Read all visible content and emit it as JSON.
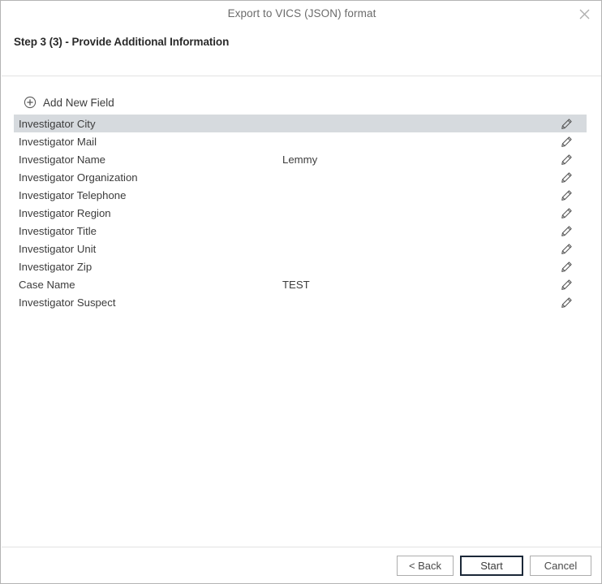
{
  "window": {
    "title": "Export to VICS (JSON) format",
    "close_icon": "close-icon"
  },
  "step": {
    "heading": "Step 3 (3) - Provide Additional Information"
  },
  "toolbar": {
    "add_field_label": "Add New Field",
    "add_field_icon": "plus-circle-icon"
  },
  "list": {
    "edit_icon": "pencil-icon",
    "selected_index": 0,
    "rows": [
      {
        "name": "Investigator City",
        "value": ""
      },
      {
        "name": "Investigator Mail",
        "value": ""
      },
      {
        "name": "Investigator Name",
        "value": "Lemmy"
      },
      {
        "name": "Investigator Organization",
        "value": ""
      },
      {
        "name": "Investigator Telephone",
        "value": ""
      },
      {
        "name": "Investigator Region",
        "value": ""
      },
      {
        "name": "Investigator Title",
        "value": ""
      },
      {
        "name": "Investigator Unit",
        "value": ""
      },
      {
        "name": "Investigator Zip",
        "value": ""
      },
      {
        "name": "Case Name",
        "value": "TEST"
      },
      {
        "name": "Investigator Suspect",
        "value": ""
      }
    ]
  },
  "footer": {
    "back_label": "< Back",
    "start_label": "Start",
    "cancel_label": "Cancel"
  },
  "colors": {
    "selection": "#d6dade",
    "default_button_border": "#1b2838",
    "separator": "#e2e2e2",
    "text": "#3c3c3c",
    "title_text": "#6b6b6b"
  }
}
